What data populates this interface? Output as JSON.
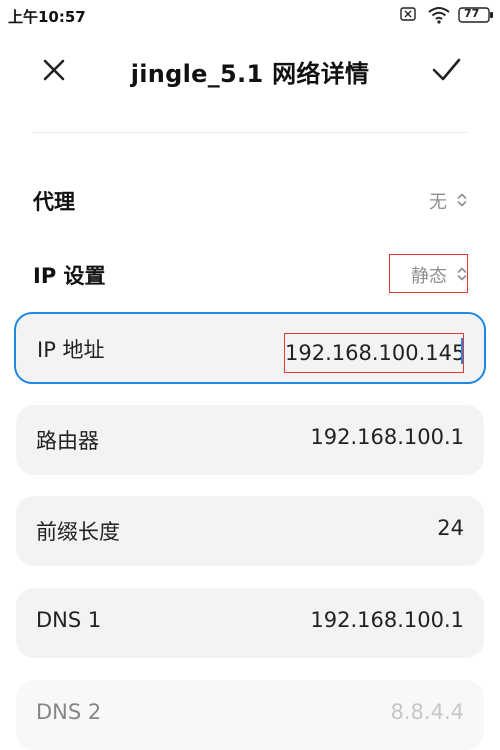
{
  "status_bar": {
    "time": "上午10:57",
    "battery": "77"
  },
  "header": {
    "title": "jingle_5.1 网络详情",
    "close_icon": "close-icon",
    "confirm_icon": "check-icon"
  },
  "proxy": {
    "label": "代理",
    "value": "无"
  },
  "ip_settings": {
    "label": "IP 设置",
    "value": "静态"
  },
  "fields": {
    "ip": {
      "label": "IP 地址",
      "value": "192.168.100.145"
    },
    "router": {
      "label": "路由器",
      "value": "192.168.100.1"
    },
    "prefix": {
      "label": "前缀长度",
      "value": "24"
    },
    "dns1": {
      "label": "DNS 1",
      "value": "192.168.100.1"
    },
    "dns2": {
      "label": "DNS 2",
      "value": "8.8.4.4"
    }
  },
  "colors": {
    "accent": "#1e88e5",
    "highlight_box": "#e53935",
    "card_bg": "#f3f3f3"
  }
}
